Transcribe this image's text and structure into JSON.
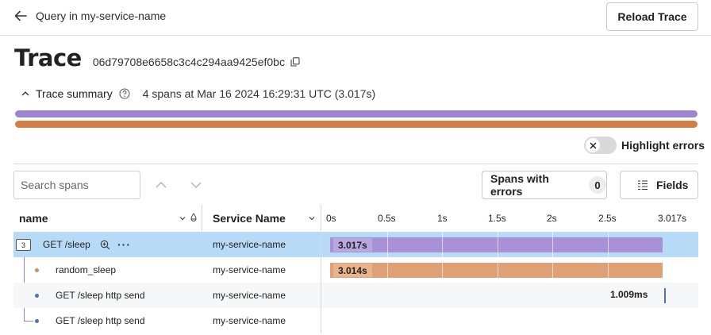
{
  "nav": {
    "back_label": "Query in my-service-name",
    "reload_label": "Reload Trace"
  },
  "header": {
    "title": "Trace",
    "trace_id": "06d79708e6658c3c4c294aa9425ef0bc"
  },
  "summary": {
    "toggle_label": "Trace summary",
    "meta": "4 spans at Mar 16 2024 16:29:31 UTC (3.017s)"
  },
  "colors": {
    "purple": "#9f85d1",
    "orange": "#d98b4f",
    "selected_row": "#b7dbf6",
    "span_purple": "#a891d6",
    "span_orange": "#dea175",
    "span_blue": "#4f6fbf"
  },
  "highlight": {
    "label": "Highlight errors",
    "enabled": false
  },
  "toolbar": {
    "search_placeholder": "Search spans",
    "errors_label": "Spans with errors",
    "errors_count": "0",
    "fields_label": "Fields"
  },
  "table": {
    "col_name": "name",
    "col_service": "Service Name",
    "ticks": [
      "0s",
      "0.5s",
      "1s",
      "1.5s",
      "2s",
      "2.5s",
      "3.017s"
    ],
    "rows": [
      {
        "name": "GET /sleep",
        "service": "my-service-name",
        "children": "3",
        "duration": "3.017s",
        "bar_color": "#a891d6"
      },
      {
        "name": "random_sleep",
        "service": "my-service-name",
        "duration": "3.014s",
        "bar_color": "#dea175"
      },
      {
        "name": "GET /sleep http send",
        "service": "my-service-name",
        "duration": "1.009ms",
        "bar_color": "#4f6fbf"
      },
      {
        "name": "GET /sleep http send",
        "service": "my-service-name",
        "duration": "",
        "bar_color": "#4f6fbf"
      }
    ]
  }
}
